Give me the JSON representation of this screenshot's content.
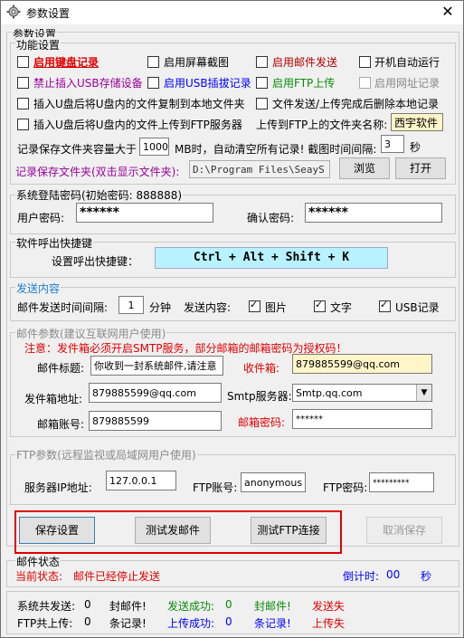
{
  "window": {
    "title": "参数设置"
  },
  "outer_group": {
    "legend": "参数设置"
  },
  "functions": {
    "legend": "功能设置",
    "opt_keyboard": "启用键盘记录",
    "opt_screenshot": "启用屏幕截图",
    "opt_mail": "启用邮件发送",
    "opt_autostart": "开机自动运行",
    "opt_usb_storage": "禁止插入USB存储设备",
    "opt_usb_log": "启用USB插拔记录",
    "opt_ftp": "启用FTP上传",
    "opt_url_log": "启用网址记录",
    "opt_copy_local": "插入U盘后将U盘内的文件复制到本地文件夹",
    "opt_delete_after": "文件发送/上传完成后删除本地记录",
    "opt_upload_ftp": "插入U盘后将U盘内的文件上传到FTP服务器",
    "ftp_folder_label": "上传到FTP上的文件夹名称:",
    "ftp_folder_value": "西宇软件",
    "capacity_label": "记录保存文件夹容量大于",
    "capacity_value": "1000",
    "capacity_suffix": "MB时，自动清空所有记录! 截图时间间隔:",
    "interval_value": "3",
    "interval_unit": "秒",
    "folder_label": "记录保存文件夹(双击显示文件夹):",
    "folder_value": "D:\\Program Files\\SeayS",
    "browse_label": "浏览",
    "open_label": "打开"
  },
  "login": {
    "legend": "系统登陆密码(初始密码: 888888)",
    "user_pw_label": "用户密码:",
    "user_pw_value": "******",
    "confirm_pw_label": "确认密码:",
    "confirm_pw_value": "******"
  },
  "hotkey": {
    "legend": "软件呼出快捷键",
    "label": "设置呼出快捷键：",
    "value": "Ctrl + Alt + Shift + K"
  },
  "send": {
    "legend": "发送内容",
    "interval_label": "邮件发送时间间隔:",
    "interval_value": "1",
    "interval_unit": "分钟",
    "content_label": "发送内容:",
    "opt_image": "图片",
    "opt_text": "文字",
    "opt_usb": "USB记录"
  },
  "mail": {
    "legend": "邮件参数(建议互联网用户使用)",
    "notice": "注意：发件箱必须开启SMTP服务，部分邮箱的邮箱密码为授权码！",
    "subject_label": "邮件标题:",
    "subject_value": "你收到一封系统邮件,请注意",
    "recipient_label": "收件箱:",
    "recipient_value": "879885599@qq.com",
    "sender_label": "发件箱地址:",
    "sender_value": "879885599@qq.com",
    "smtp_label": "Smtp服务器:",
    "smtp_value": "Smtp.qq.com",
    "account_label": "邮箱账号:",
    "account_value": "879885599",
    "password_label": "邮箱密码:",
    "password_value": "******"
  },
  "ftp": {
    "legend": "FTP参数(远程监视或局域网用户使用)",
    "ip_label": "服务器IP地址:",
    "ip_value": "127.0.0.1",
    "account_label": "FTP账号:",
    "account_value": "anonymous",
    "password_label": "FTP密码:",
    "password_value": "*********"
  },
  "actions": {
    "save": "保存设置",
    "test_mail": "测试发邮件",
    "test_ftp": "测试FTP连接",
    "cancel": "取消保存"
  },
  "status": {
    "legend": "邮件状态",
    "current_label": "当前状态:",
    "current_value": "邮件已经停止发送",
    "countdown_label": "倒计时:",
    "countdown_value": "00",
    "countdown_unit": "秒"
  },
  "stats": {
    "row1": {
      "total_label": "系统共发送:",
      "total_value": "0",
      "mail_label": "封邮件!",
      "success_label": "发送成功:",
      "success_value": "0",
      "mail_label2": "封邮件!",
      "fail_label": "发送失"
    },
    "row2": {
      "total_label": "FTP共上传:",
      "total_value": "0",
      "rec_label": "条记录!",
      "success_label": "上传成功:",
      "success_value": "0",
      "rec_label2": "条记录!",
      "fail_label": "上传失"
    }
  },
  "colors": {
    "highlight_border": "#e00000",
    "hotkey_bg": "#b9f2ff",
    "yellow_field": "#fff5c8"
  }
}
